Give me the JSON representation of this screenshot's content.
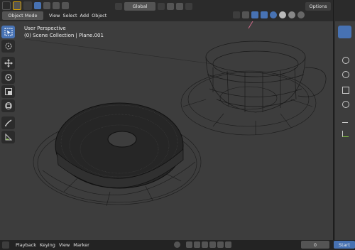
{
  "header": {
    "mode_label": "Object Mode",
    "menu": [
      "View",
      "Select",
      "Add",
      "Object"
    ],
    "orientation_label": "Global",
    "options_label": "Options"
  },
  "viewport": {
    "view_name": "User Perspective",
    "collection_info": "(0) Scene Collection | Plane.001"
  },
  "timeline": {
    "menu": [
      "Playback",
      "Keying",
      "View",
      "Marker"
    ],
    "current_frame": "0",
    "start_label": "Start"
  },
  "colors": {
    "accent": "#4772b3",
    "header_bg": "#2b2b2b",
    "viewport_bg": "#3d3d3d",
    "wire": "#141414"
  },
  "icons": {
    "tools": [
      "select-box-icon",
      "cursor-icon",
      "move-icon",
      "rotate-icon",
      "scale-icon",
      "transform-icon",
      "annotate-icon",
      "measure-icon"
    ]
  }
}
